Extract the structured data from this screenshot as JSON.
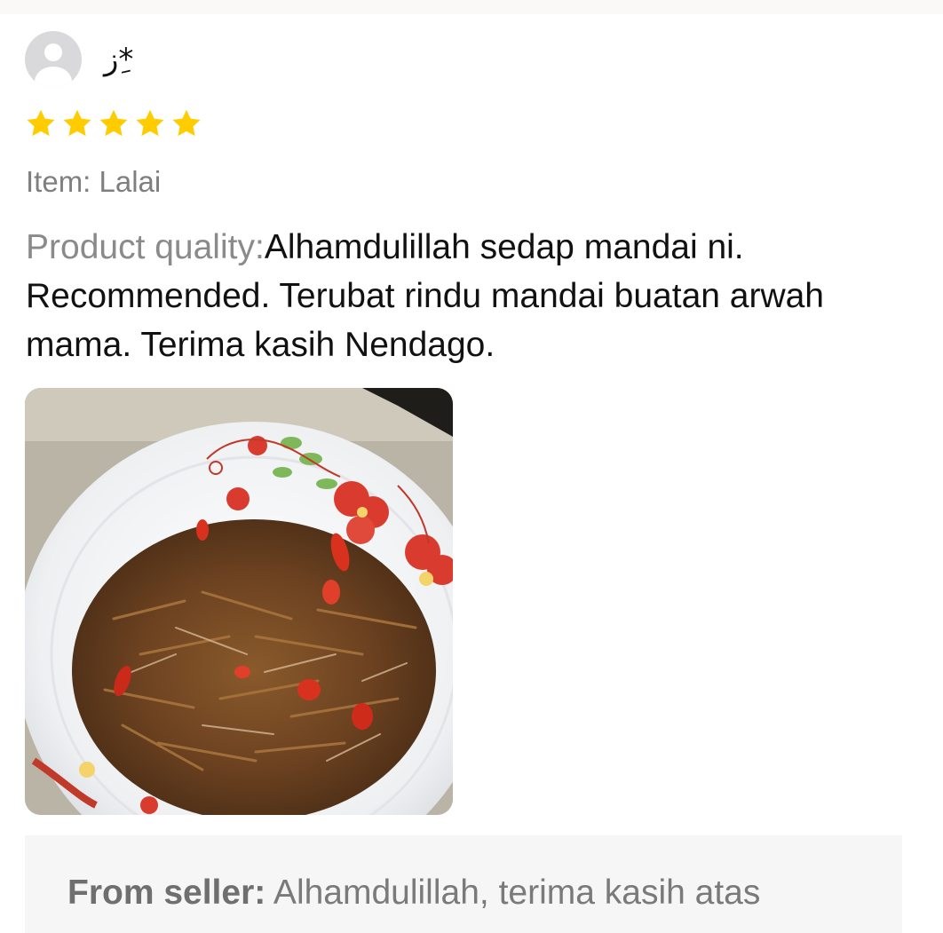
{
  "review": {
    "username": "ﺯ*ِ",
    "rating": 5,
    "max_rating": 5,
    "star_color": "#ffcc00",
    "item_label": "Item: Lalai",
    "quality_label": "Product quality:",
    "comment": "Alhamdulillah sedap mandai ni. Recommended. Terubat rindu mandai buatan arwah mama. Terima kasih Nendago.",
    "photo_icon": "review-photo"
  },
  "seller_reply": {
    "label": "From seller:",
    "text": " Alhamdulillah, terima kasih atas"
  },
  "colors": {
    "primary_text": "#111111",
    "secondary_text": "#7f7f7f",
    "reply_background": "#f6f6f6"
  }
}
